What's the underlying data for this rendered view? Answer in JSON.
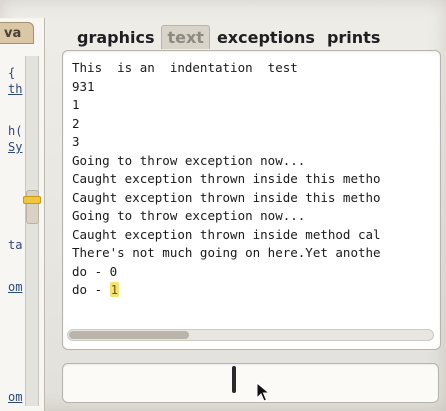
{
  "left_pane": {
    "tab_label": "va",
    "code_fragments": [
      "{",
      "th",
      "h(",
      "Sy",
      "ta",
      "om",
      "om"
    ],
    "scroll_marker_color": "#f2c63c"
  },
  "tabs": [
    {
      "label": "graphics",
      "active": false
    },
    {
      "label": "text",
      "active": true
    },
    {
      "label": "exceptions",
      "active": false
    },
    {
      "label": "prints",
      "active": false
    }
  ],
  "output": {
    "lines": [
      "This  is an  indentation  test",
      "931",
      "1",
      "2",
      "3",
      "Going to throw exception now...",
      "Caught exception thrown inside this metho",
      "Caught exception thrown inside this metho",
      "Going to throw exception now...",
      "Caught exception thrown inside method cal",
      "There's not much going on here.Yet anothe",
      "do - 0"
    ],
    "last_line_prefix": "do - ",
    "last_line_highlight": "1",
    "highlight_color": "#f7e36b"
  },
  "input": {
    "value": ""
  }
}
